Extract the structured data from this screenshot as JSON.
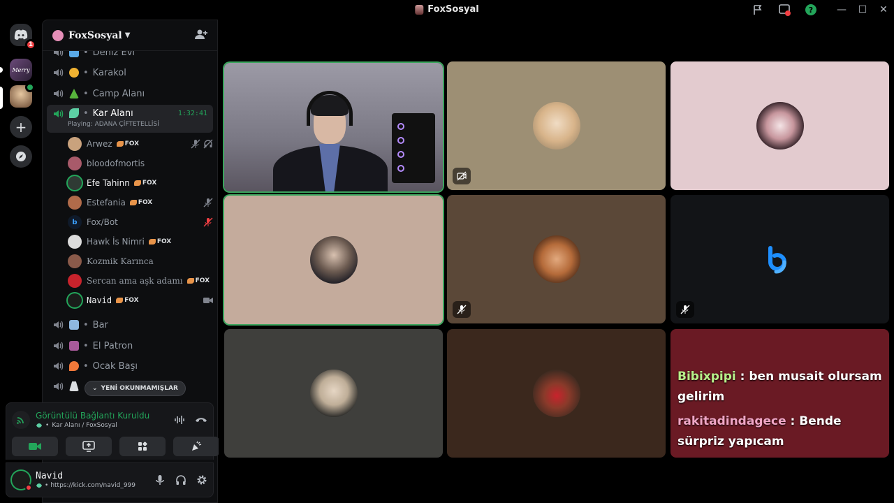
{
  "window": {
    "title": "FoxSosyal"
  },
  "rail": {
    "home_badge": "1",
    "server1_label": "Merry"
  },
  "server": {
    "name": "FoxSosyal"
  },
  "channels": [
    {
      "name": "Deniz Evi",
      "emoji_color": "#5aa9e6"
    },
    {
      "name": "Karakol",
      "emoji_color": "#f0b232"
    },
    {
      "name": "Camp Alanı",
      "emoji_color": "#57b53c"
    },
    {
      "name": "Kar Alanı",
      "emoji_color": "#5dcfa4",
      "timer": "1:32:41",
      "playing": "Playing: ADANA ÇİFTETELLİSİ"
    },
    {
      "name": "Bar",
      "emoji_color": "#8fb8e0"
    },
    {
      "name": "El Patron",
      "emoji_color": "#a85a9a"
    },
    {
      "name": "Ocak Başı",
      "emoji_color": "#f0793a"
    },
    {
      "name": "",
      "emoji_color": "#dbdee1"
    }
  ],
  "members": [
    {
      "name": "Arwez",
      "tag": "FOX",
      "avatar": "#c9a27d"
    },
    {
      "name": "bloodofmortis",
      "tag": "",
      "avatar": "#a85a6a"
    },
    {
      "name": "Efe Tahinn",
      "tag": "FOX",
      "avatar": "#2f3a34"
    },
    {
      "name": "Estefania",
      "tag": "FOX",
      "avatar": "#b06b4a"
    },
    {
      "name": "Fox/Bot",
      "tag": "",
      "avatar": "#0f1a2a"
    },
    {
      "name": "Hawk İs Nimri",
      "tag": "FOX",
      "avatar": "#dcdcdc"
    },
    {
      "name": "Kozmik Karınca",
      "tag": "",
      "avatar": "#8a5a4a"
    },
    {
      "name": "Sercan ama aşk adamı",
      "tag": "FOX",
      "avatar": "#c8232c"
    },
    {
      "name": "Navid",
      "tag": "FOX",
      "avatar": "#1a1c1a"
    }
  ],
  "unread_label": "YENİ OKUNMAMIŞLAR",
  "voice": {
    "status": "Görüntülü Bağlantı Kuruldu",
    "location": "Kar Alanı / FoxSosyal"
  },
  "user": {
    "name": "Navid",
    "status": "https://kick.com/navid_999"
  },
  "chat": {
    "user1": "Bibixpipi",
    "msg1": " : ben musait olursam gelirim",
    "user2": "rakitadindagece",
    "msg2": " : Bende sürpriz yapıcam"
  },
  "colors": {
    "accent_green": "#23a55a",
    "speaking_border": "#3ba55d",
    "danger": "#f23f43"
  }
}
